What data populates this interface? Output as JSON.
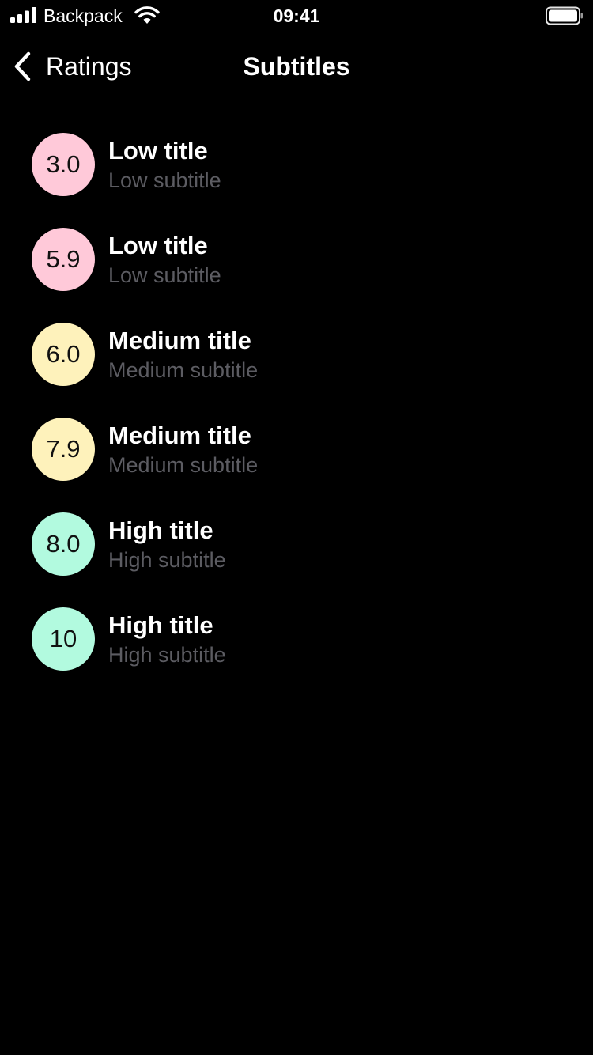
{
  "status_bar": {
    "carrier": "Backpack",
    "time": "09:41",
    "icons": [
      "signal-icon",
      "wifi-icon",
      "battery-icon"
    ]
  },
  "nav": {
    "back_label": "Ratings",
    "title": "Subtitles",
    "back_icon": "chevron-left-icon"
  },
  "colors": {
    "background": "#000000",
    "text_primary": "#ffffff",
    "text_secondary": "#5c5c62",
    "low": "#ffc9d9",
    "medium": "#fef2bb",
    "high": "#b2fadf"
  },
  "ratings": [
    {
      "value": "3.0",
      "level": "low",
      "title": "Low title",
      "subtitle": "Low subtitle"
    },
    {
      "value": "5.9",
      "level": "low",
      "title": "Low title",
      "subtitle": "Low subtitle"
    },
    {
      "value": "6.0",
      "level": "medium",
      "title": "Medium title",
      "subtitle": "Medium subtitle"
    },
    {
      "value": "7.9",
      "level": "medium",
      "title": "Medium title",
      "subtitle": "Medium subtitle"
    },
    {
      "value": "8.0",
      "level": "high",
      "title": "High title",
      "subtitle": "High subtitle"
    },
    {
      "value": "10",
      "level": "high",
      "title": "High title",
      "subtitle": "High subtitle"
    }
  ]
}
